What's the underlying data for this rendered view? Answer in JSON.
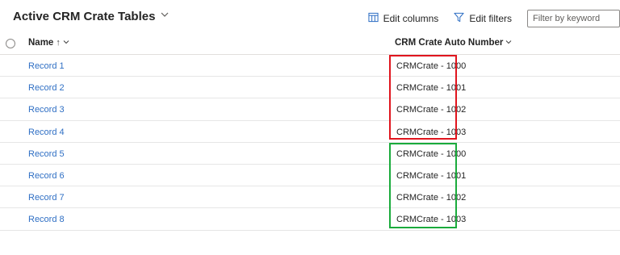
{
  "header": {
    "view_title": "Active CRM Crate Tables",
    "edit_columns_label": "Edit columns",
    "edit_filters_label": "Edit filters",
    "filter_placeholder": "Filter by keyword"
  },
  "grid": {
    "columns": {
      "name": "Name",
      "name_sort": "↑",
      "auto_number": "CRM Crate Auto Number"
    },
    "rows": [
      {
        "name": "Record 1",
        "auto_number": "CRMCrate - 1000"
      },
      {
        "name": "Record 2",
        "auto_number": "CRMCrate - 1001"
      },
      {
        "name": "Record 3",
        "auto_number": "CRMCrate - 1002"
      },
      {
        "name": "Record 4",
        "auto_number": "CRMCrate - 1003"
      },
      {
        "name": "Record 5",
        "auto_number": "CRMCrate - 1000"
      },
      {
        "name": "Record 6",
        "auto_number": "CRMCrate - 1001"
      },
      {
        "name": "Record 7",
        "auto_number": "CRMCrate - 1002"
      },
      {
        "name": "Record 8",
        "auto_number": "CRMCrate - 1003"
      }
    ]
  },
  "highlights": {
    "first_group_color": "#e0151e",
    "second_group_color": "#1aab3c"
  },
  "colors": {
    "link": "#2f6fc4",
    "text": "#242424",
    "icon_accent": "#2f6fc4"
  }
}
